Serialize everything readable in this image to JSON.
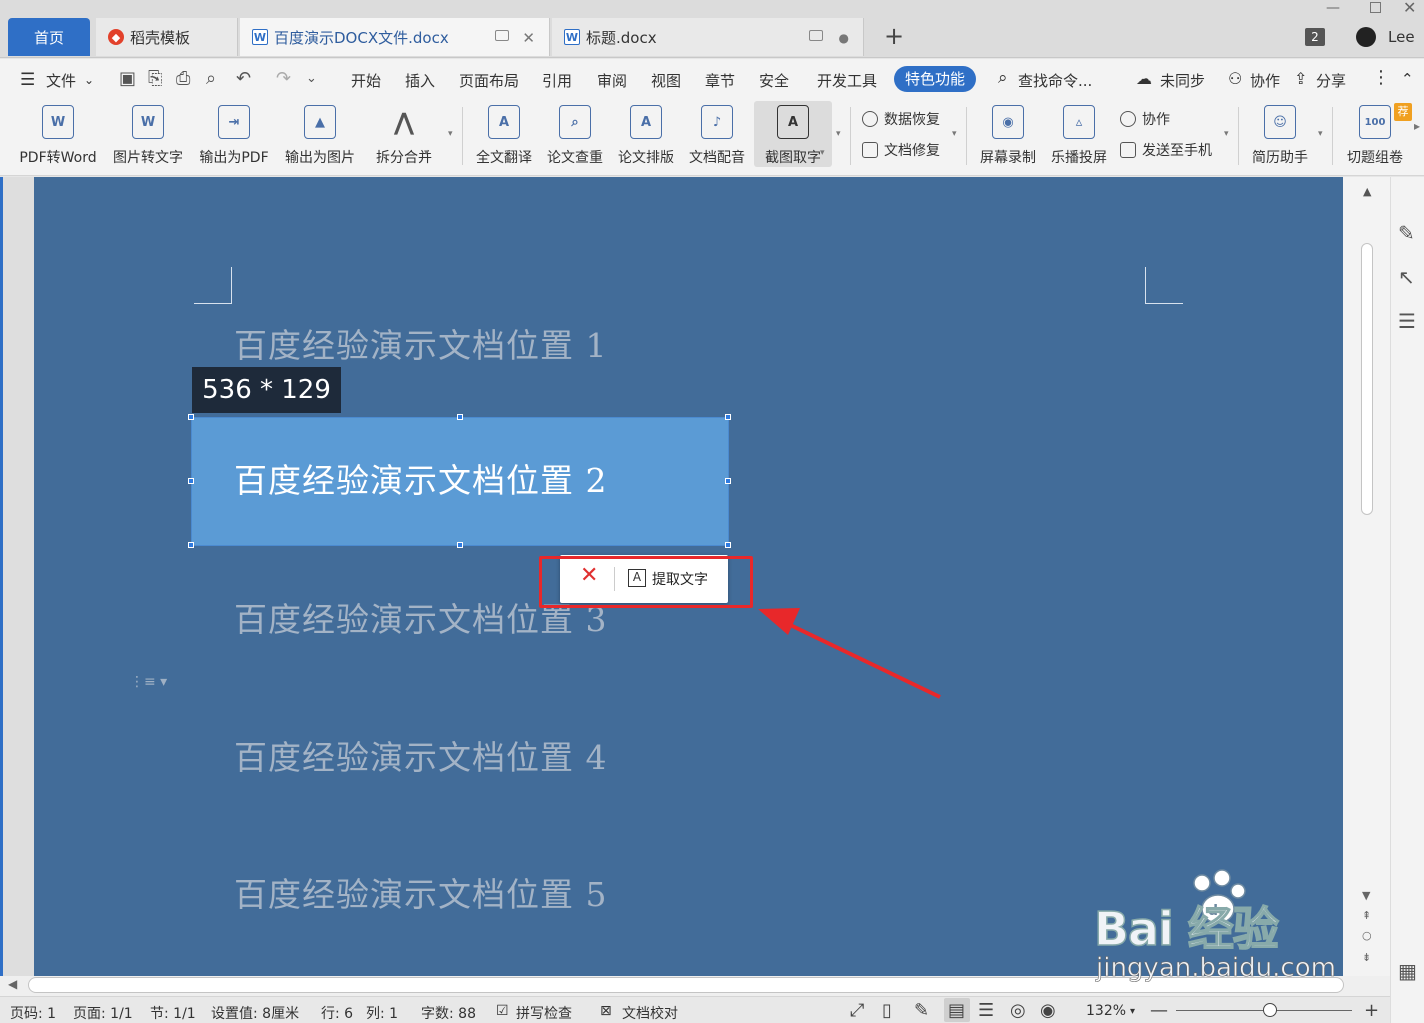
{
  "tabs": {
    "home": "首页",
    "docer": "稻壳模板",
    "doc1": "百度演示DOCX文件.docx",
    "doc2": "标题.docx",
    "count": "2",
    "user": "Lee"
  },
  "menu": {
    "file": "文件",
    "items": [
      "开始",
      "插入",
      "页面布局",
      "引用",
      "审阅",
      "视图",
      "章节",
      "安全",
      "开发工具"
    ],
    "special": "特色功能",
    "search": "查找命令...",
    "sync": "未同步",
    "collab": "协作",
    "share": "分享"
  },
  "ribbon": {
    "pdf2word": "PDF转Word",
    "img2text": "图片转文字",
    "export_pdf": "输出为PDF",
    "export_img": "输出为图片",
    "split_merge": "拆分合并",
    "translate": "全文翻译",
    "plagiarism": "论文查重",
    "layout": "论文排版",
    "dubbing": "文档配音",
    "screenshot_ocr": "截图取字",
    "data_recovery": "数据恢复",
    "doc_repair": "文档修复",
    "screen_record": "屏幕录制",
    "cast": "乐播投屏",
    "collab": "协作",
    "send_phone": "发送至手机",
    "resume": "简历助手",
    "quiz": "切题组卷",
    "quiz_badge": "荐"
  },
  "document": {
    "paragraphs": [
      "百度经验演示文档位置 1",
      "百度经验演示文档位置 2",
      "百度经验演示文档位置 3",
      "百度经验演示文档位置 4",
      "百度经验演示文档位置 5"
    ],
    "selection_size": "536 * 129",
    "popup": {
      "close": "✕",
      "extract": "提取文字"
    }
  },
  "status": {
    "page_no": "页码: 1",
    "pages": "页面: 1/1",
    "section": "节: 1/1",
    "setting": "设置值: 8厘米",
    "row": "行: 6",
    "col": "列: 1",
    "words": "字数: 88",
    "spell": "拼写检查",
    "proof": "文档校对",
    "zoom": "132%"
  },
  "watermark": {
    "brand": "Bai  经验",
    "du": "du",
    "url": "jingyan.baidu.com"
  },
  "colors": {
    "accent": "#2f6fc6",
    "page": "#426c99",
    "selection": "#5b9bd5",
    "highlight": "#e8282a"
  }
}
